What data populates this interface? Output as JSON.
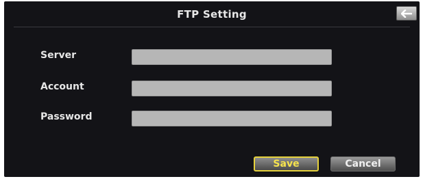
{
  "window": {
    "title": "FTP Setting"
  },
  "icons": {
    "back": "back-arrow-icon"
  },
  "form": {
    "fields": [
      {
        "label": "Server",
        "value": ""
      },
      {
        "label": "Account",
        "value": ""
      },
      {
        "label": "Password",
        "value": ""
      }
    ]
  },
  "actions": {
    "save_label": "Save",
    "cancel_label": "Cancel"
  },
  "colors": {
    "background": "#131317",
    "input_fill": "#b6b6b6",
    "save_accent": "#f6e34d"
  }
}
